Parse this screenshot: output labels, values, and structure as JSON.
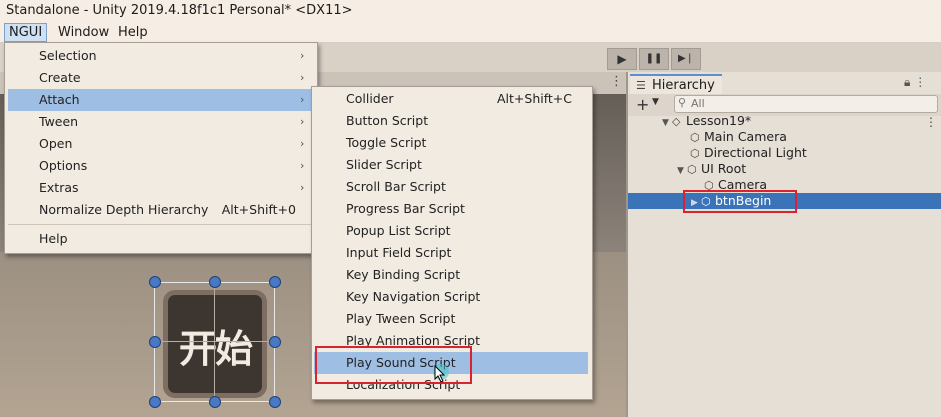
{
  "window": {
    "title": "Standalone - Unity 2019.4.18f1c1 Personal* <DX11>"
  },
  "menubar": {
    "items": [
      "NGUI",
      "Window",
      "Help"
    ]
  },
  "toolbar": {
    "play": "▶",
    "pause": "❚❚",
    "step": "▶❘"
  },
  "scene": {
    "button_text": "开始"
  },
  "ngui_menu": {
    "items": [
      {
        "label": "Selection",
        "submenu": true
      },
      {
        "label": "Create",
        "submenu": true
      },
      {
        "label": "Attach",
        "submenu": true
      },
      {
        "label": "Tween",
        "submenu": true
      },
      {
        "label": "Open",
        "submenu": true
      },
      {
        "label": "Options",
        "submenu": true
      },
      {
        "label": "Extras",
        "submenu": true
      },
      {
        "label": "Normalize Depth Hierarchy",
        "shortcut": "Alt+Shift+0"
      },
      {
        "label": "Help"
      }
    ]
  },
  "attach_menu": {
    "items": [
      {
        "label": "Collider",
        "shortcut": "Alt+Shift+C"
      },
      {
        "label": "Button Script"
      },
      {
        "label": "Toggle Script"
      },
      {
        "label": "Slider Script"
      },
      {
        "label": "Scroll Bar Script"
      },
      {
        "label": "Progress Bar Script"
      },
      {
        "label": "Popup List Script"
      },
      {
        "label": "Input Field Script"
      },
      {
        "label": "Key Binding Script"
      },
      {
        "label": "Key Navigation Script"
      },
      {
        "label": "Play Tween Script"
      },
      {
        "label": "Play Animation Script"
      },
      {
        "label": "Play Sound Script"
      },
      {
        "label": "Localization Script"
      }
    ],
    "highlighted": "Play Sound Script"
  },
  "hierarchy": {
    "tab_label": "Hierarchy",
    "search_placeholder": "All",
    "items": [
      {
        "label": "Lesson19*",
        "depth": 0,
        "expanded": true,
        "scene": true
      },
      {
        "label": "Main Camera",
        "depth": 1
      },
      {
        "label": "Directional Light",
        "depth": 1
      },
      {
        "label": "UI Root",
        "depth": 1,
        "expanded": true
      },
      {
        "label": "Camera",
        "depth": 2
      },
      {
        "label": "btnBegin",
        "depth": 2,
        "selected": true,
        "collapsed": true
      }
    ]
  },
  "colors": {
    "selection": "#3b73b9",
    "menu_highlight": "#9ebfe3",
    "annotation": "#d9232f"
  }
}
